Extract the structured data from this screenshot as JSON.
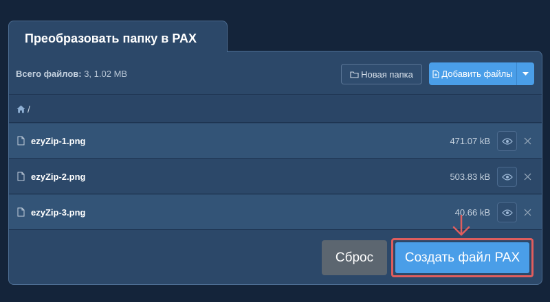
{
  "tab": {
    "title": "Преобразовать папку в PAX"
  },
  "toolbar": {
    "total_label": "Всего файлов:",
    "total_value": " 3, 1.02 MB",
    "new_folder_label": "Новая папка",
    "add_files_label": "Добавить файлы"
  },
  "path": {
    "separator": "/"
  },
  "files": [
    {
      "name": "ezyZip-1.png",
      "size": "471.07 kB"
    },
    {
      "name": "ezyZip-2.png",
      "size": "503.83 kB"
    },
    {
      "name": "ezyZip-3.png",
      "size": "40.66 kB"
    }
  ],
  "actions": {
    "reset_label": "Сброс",
    "create_label": "Создать файл PAX"
  },
  "icons": {
    "home": "home-icon",
    "folder": "folder-icon",
    "file_add": "file-add-icon",
    "chevron": "chevron-down-icon",
    "file": "file-icon",
    "eye": "eye-icon",
    "close": "close-icon",
    "arrow": "arrow-down-annotation"
  },
  "colors": {
    "background": "#14243a",
    "panel": "#2c4869",
    "accent": "#4a9ee8",
    "highlight": "#e05d5d",
    "reset": "#5c6670"
  }
}
